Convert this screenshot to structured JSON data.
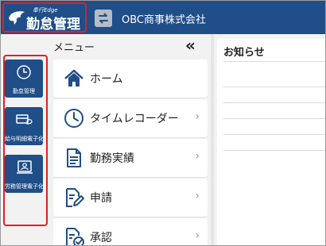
{
  "header": {
    "logo_small": "奉行Edge",
    "logo_title": "勤怠管理",
    "company": "OBC商事株式会社"
  },
  "rail": {
    "items": [
      {
        "label": "勤怠管理",
        "icon": "clock-icon"
      },
      {
        "label": "給与明細電子化",
        "icon": "payslip-icon"
      },
      {
        "label": "労務管理電子化",
        "icon": "labor-doc-icon"
      }
    ]
  },
  "menu": {
    "title": "メニュー",
    "collapse_glyph": "«",
    "items": [
      {
        "label": "ホーム",
        "icon": "home-icon",
        "chevron": ""
      },
      {
        "label": "タイムレコーダー",
        "icon": "clock-icon",
        "chevron": "›"
      },
      {
        "label": "勤務実績",
        "icon": "document-icon",
        "chevron": "›"
      },
      {
        "label": "申請",
        "icon": "edit-document-icon",
        "chevron": "›"
      },
      {
        "label": "承認",
        "icon": "approve-document-icon",
        "chevron": "›"
      }
    ]
  },
  "notice": {
    "title": "お知らせ"
  },
  "colors": {
    "brand": "#1f4e89",
    "highlight": "#e02020"
  }
}
